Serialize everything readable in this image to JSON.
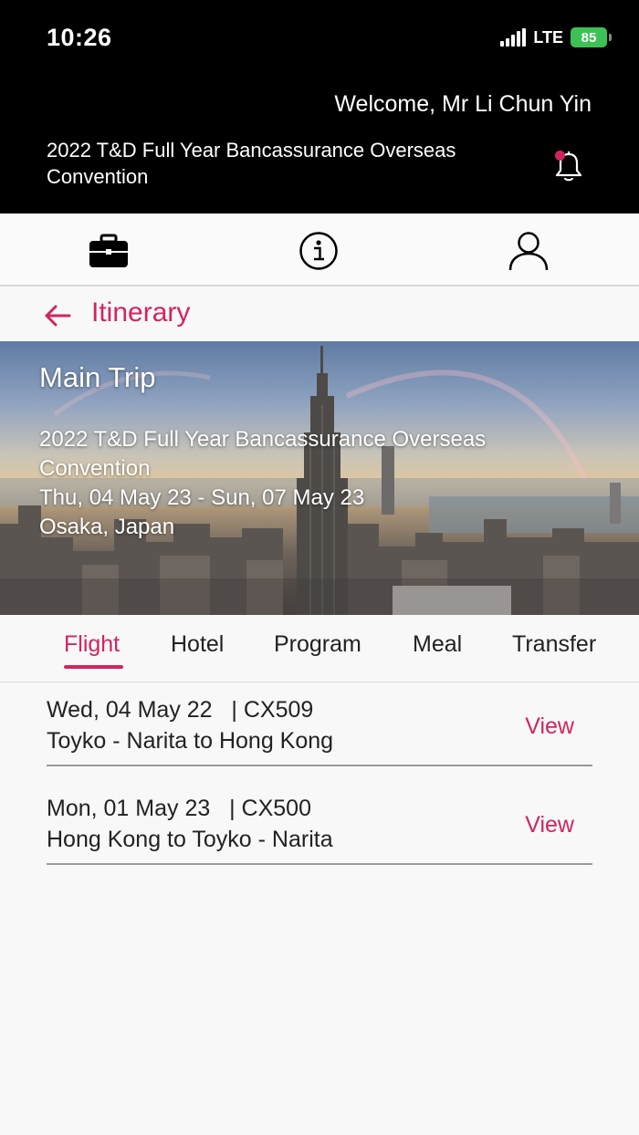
{
  "status_bar": {
    "time": "10:26",
    "network": "LTE",
    "battery": "85"
  },
  "header": {
    "welcome": "Welcome, Mr Li Chun Yin",
    "event_title": "2022 T&D Full Year Bancassurance Overseas Convention",
    "notification_icon": "bell-icon"
  },
  "nav": {
    "items": [
      {
        "icon": "briefcase-icon"
      },
      {
        "icon": "info-icon"
      },
      {
        "icon": "user-icon"
      }
    ]
  },
  "page": {
    "title": "Itinerary",
    "back_icon": "arrow-left-icon"
  },
  "trip": {
    "label": "Main Trip",
    "event_name": "2022 T&D Full Year Bancassurance Overseas Convention",
    "dates": "Thu, 04 May 23 - Sun, 07 May 23",
    "location": "Osaka, Japan"
  },
  "tabs": [
    {
      "label": "Flight",
      "active": true
    },
    {
      "label": "Hotel",
      "active": false
    },
    {
      "label": "Program",
      "active": false
    },
    {
      "label": "Meal",
      "active": false
    },
    {
      "label": "Transfer",
      "active": false
    }
  ],
  "flights": [
    {
      "date_flight": "Wed, 04 May 22   | CX509",
      "route": "Toyko - Narita to Hong Kong",
      "action": "View"
    },
    {
      "date_flight": "Mon, 01 May 23   | CX500",
      "route": "Hong Kong to Toyko - Narita",
      "action": "View"
    }
  ],
  "colors": {
    "accent": "#d3245e",
    "header_bg": "#000000",
    "page_bg": "#f8f8f8",
    "battery": "#3cc254"
  }
}
